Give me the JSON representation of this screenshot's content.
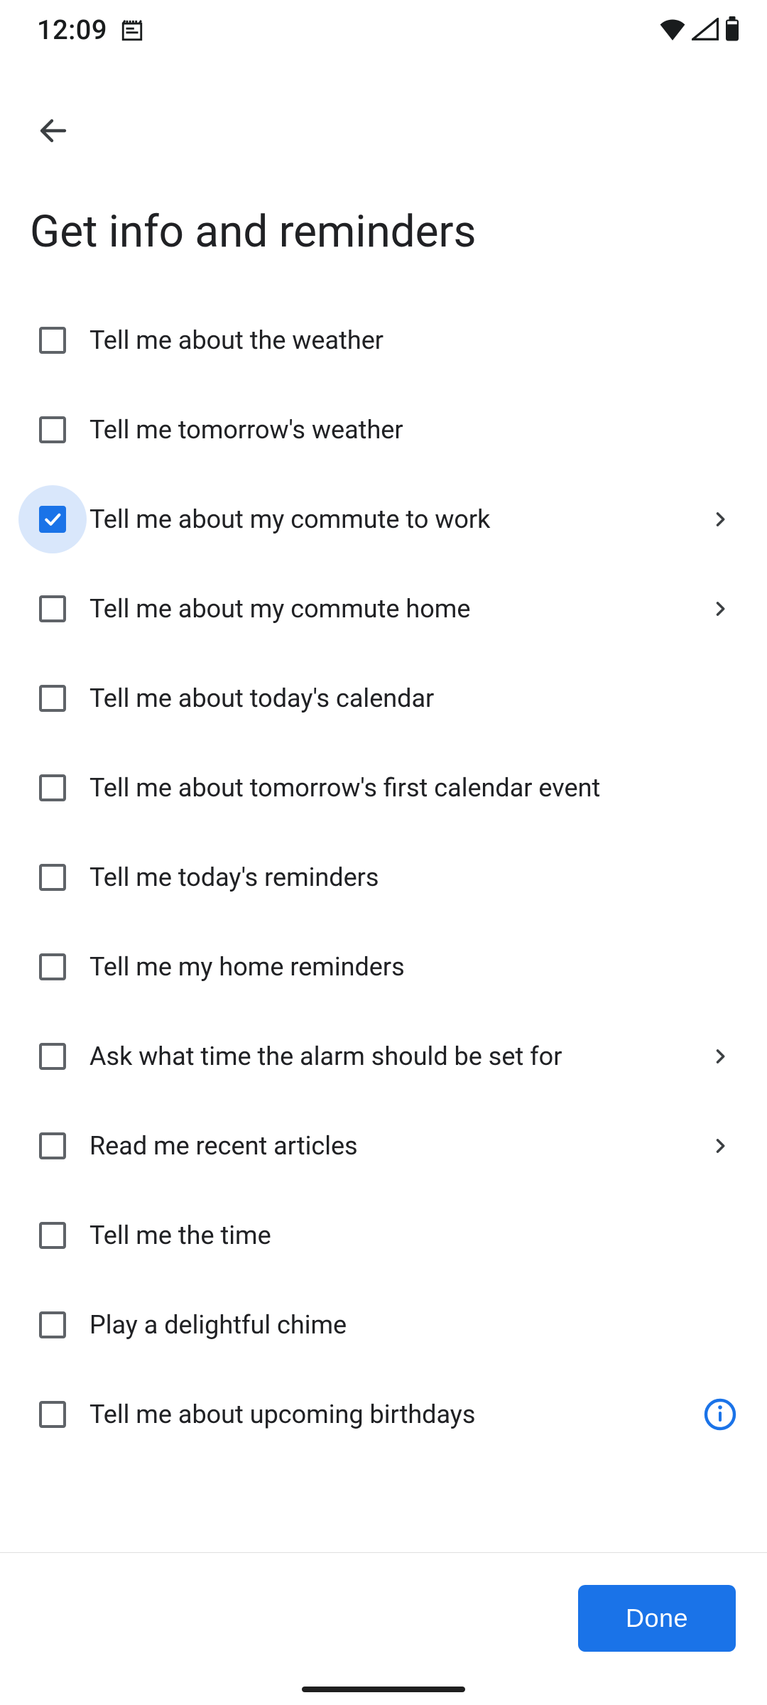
{
  "status": {
    "time": "12:09"
  },
  "page": {
    "title": "Get info and reminders"
  },
  "items": [
    {
      "label": "Tell me about the weather",
      "checked": false,
      "highlight": false,
      "chevron": false,
      "info": false
    },
    {
      "label": "Tell me tomorrow's weather",
      "checked": false,
      "highlight": false,
      "chevron": false,
      "info": false
    },
    {
      "label": "Tell me about my commute to work",
      "checked": true,
      "highlight": true,
      "chevron": true,
      "info": false
    },
    {
      "label": "Tell me about my commute home",
      "checked": false,
      "highlight": false,
      "chevron": true,
      "info": false
    },
    {
      "label": "Tell me about today's calendar",
      "checked": false,
      "highlight": false,
      "chevron": false,
      "info": false
    },
    {
      "label": "Tell me about tomorrow's first calendar event",
      "checked": false,
      "highlight": false,
      "chevron": false,
      "info": false
    },
    {
      "label": "Tell me today's reminders",
      "checked": false,
      "highlight": false,
      "chevron": false,
      "info": false
    },
    {
      "label": "Tell me my home reminders",
      "checked": false,
      "highlight": false,
      "chevron": false,
      "info": false
    },
    {
      "label": "Ask what time the alarm should be set for",
      "checked": false,
      "highlight": false,
      "chevron": true,
      "info": false
    },
    {
      "label": "Read me recent articles",
      "checked": false,
      "highlight": false,
      "chevron": true,
      "info": false
    },
    {
      "label": "Tell me the time",
      "checked": false,
      "highlight": false,
      "chevron": false,
      "info": false
    },
    {
      "label": "Play a delightful chime",
      "checked": false,
      "highlight": false,
      "chevron": false,
      "info": false
    },
    {
      "label": "Tell me about upcoming birthdays",
      "checked": false,
      "highlight": false,
      "chevron": false,
      "info": true
    }
  ],
  "footer": {
    "done": "Done"
  }
}
